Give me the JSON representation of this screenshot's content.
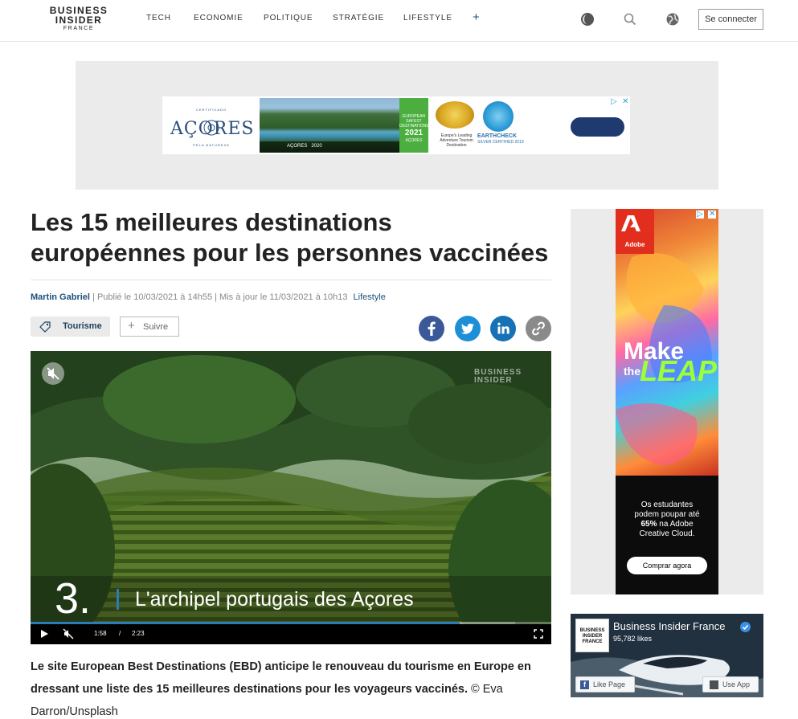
{
  "header": {
    "logo_line1": "BUSINESS",
    "logo_line2": "INSIDER",
    "logo_line3": "FRANCE",
    "nav": [
      "TECH",
      "ECONOMIE",
      "POLITIQUE",
      "STRATÉGIE",
      "LIFESTYLE"
    ],
    "nav_more": "+",
    "icons": [
      "dark-mode-icon",
      "search-icon",
      "globe-icon"
    ],
    "login_label": "Se connecter"
  },
  "top_ad": {
    "brand": "AÇORES",
    "arc_top": "CERTIFICADO",
    "arc_bottom": "PELA NATUREZA",
    "strip_text": "AÇORES   2020",
    "badge_lines": [
      "EUROPEAN",
      "SAFEST",
      "DESTINATIONS"
    ],
    "badge_year": "2021",
    "badge_sub": "AÇORES",
    "award_text": "Europe's Leading Adventure Tourism Destination",
    "earthcheck": "EARTHCHECK",
    "earthcheck_sub": "SILVER CERTIFIED 2019",
    "adchoices_icon": "adchoices-icon",
    "close_icon": "close-icon"
  },
  "article": {
    "title": "Les 15 meilleures destinations européennes pour les personnes vaccinées",
    "author": "Martin Gabriel",
    "published": "| Publié le 10/03/2021 à 14h55",
    "updated": "| Mis à jour le 11/03/2021 à 10h13",
    "category": "Lifestyle",
    "tag_label": "Tourisme",
    "follow_label": "Suivre",
    "share_icons": [
      "facebook-icon",
      "twitter-icon",
      "linkedin-icon",
      "link-icon"
    ],
    "share_colors": [
      "#3b5998",
      "#1d8fd6",
      "#1771b7",
      "#8a8a8a"
    ],
    "caption_bold": "Le site European Best Destinations (EBD) anticipe le renouveau du tourisme en Europe en dressant une liste des 15 meilleures destinations pour les voyageurs vaccinés.",
    "caption_credit": "© Eva Darron/Unsplash"
  },
  "video": {
    "watermark_line1": "BUSINESS",
    "watermark_line2": "INSIDER",
    "caption_number": "3.",
    "caption_text": "L'archipel portugais des Açores",
    "current_time": "1:58",
    "time_separator": "/",
    "duration": "2:23",
    "progress_fraction": 0.8248,
    "buffered_fraction": 0.93,
    "accent_color": "#2a7bb8"
  },
  "side_ad": {
    "brand": "Adobe",
    "headline_1": "Make",
    "headline_2": "the",
    "headline_3": "LEAP",
    "body_line1": "Os estudantes",
    "body_line2": "podem poupar até",
    "body_pct": "65%",
    "body_line3": " na Adobe",
    "body_line4": "Creative Cloud.",
    "cta": "Comprar agora"
  },
  "facebook": {
    "logo_line1": "BUSINESS",
    "logo_line2": "INSIDER",
    "logo_line3": "FRANCE",
    "page_name": "Business Insider France",
    "likes": "95,782 likes",
    "like_label": "Like Page",
    "use_app_label": "Use App"
  }
}
